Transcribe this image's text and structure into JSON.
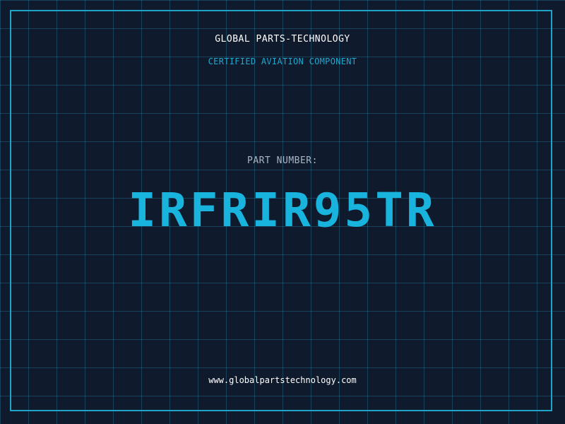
{
  "header": {
    "company": "GLOBAL PARTS-TECHNOLOGY",
    "subtitle": "CERTIFIED AVIATION COMPONENT"
  },
  "part": {
    "label": "PART NUMBER:",
    "number": "IRFRIR95TR"
  },
  "footer": {
    "url": "www.globalpartstechnology.com"
  },
  "colors": {
    "background": "#0f1a2d",
    "accent": "#1fa3c9",
    "part_number": "#19b4dd",
    "text": "#ffffff",
    "label": "#a8b6c6"
  }
}
